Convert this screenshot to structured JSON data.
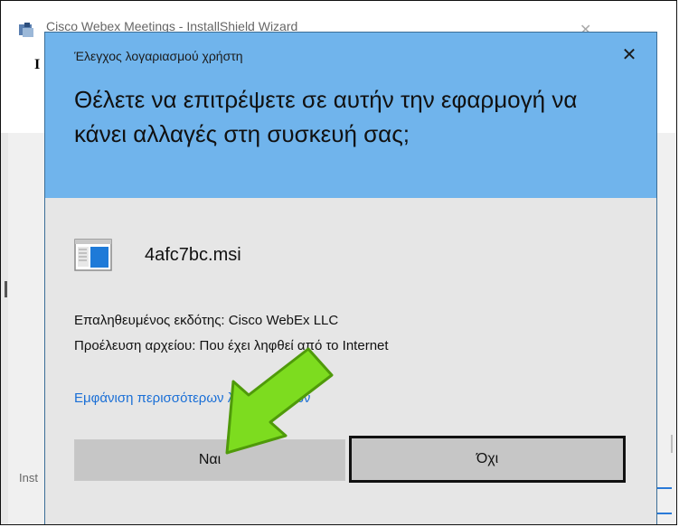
{
  "background_window": {
    "title": "Cisco Webex Meetings - InstallShield Wizard",
    "header_letter": "I",
    "status_text": "Inst"
  },
  "uac": {
    "caption": "Έλεγχος λογαριασμού χρήστη",
    "question": "Θέλετε να επιτρέψετε σε αυτήν την εφαρμογή να κάνει αλλαγές στη συσκευή σας;",
    "file_name": "4afc7bc.msi",
    "publisher_line": "Επαληθευμένος εκδότης: Cisco WebEx LLC",
    "origin_line": "Προέλευση αρχείου: Που έχει ληφθεί από το Internet",
    "details_link": "Εμφάνιση περισσότερων λεπτομερειών",
    "yes_label": "Ναι",
    "no_label": "Όχι",
    "close_symbol": "✕"
  },
  "colors": {
    "header_blue": "#70b4ec",
    "dialog_gray": "#e6e6e6",
    "link_blue": "#1a6fd6",
    "arrow_green": "#7ddc1f"
  },
  "icons": {
    "app_icon": "installer-icon",
    "file_icon": "msi-file-icon",
    "close_icon": "close-icon",
    "annotation": "green-arrow"
  }
}
